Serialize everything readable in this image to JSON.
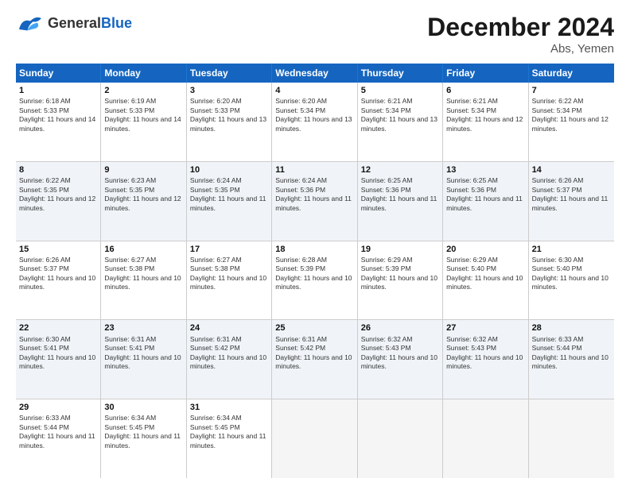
{
  "header": {
    "logo_general": "General",
    "logo_blue": "Blue",
    "month_title": "December 2024",
    "location": "Abs, Yemen"
  },
  "calendar": {
    "days_of_week": [
      "Sunday",
      "Monday",
      "Tuesday",
      "Wednesday",
      "Thursday",
      "Friday",
      "Saturday"
    ],
    "weeks": [
      [
        {
          "day": "1",
          "sunrise": "6:18 AM",
          "sunset": "5:33 PM",
          "daylight": "11 hours and 14 minutes."
        },
        {
          "day": "2",
          "sunrise": "6:19 AM",
          "sunset": "5:33 PM",
          "daylight": "11 hours and 14 minutes."
        },
        {
          "day": "3",
          "sunrise": "6:20 AM",
          "sunset": "5:33 PM",
          "daylight": "11 hours and 13 minutes."
        },
        {
          "day": "4",
          "sunrise": "6:20 AM",
          "sunset": "5:34 PM",
          "daylight": "11 hours and 13 minutes."
        },
        {
          "day": "5",
          "sunrise": "6:21 AM",
          "sunset": "5:34 PM",
          "daylight": "11 hours and 13 minutes."
        },
        {
          "day": "6",
          "sunrise": "6:21 AM",
          "sunset": "5:34 PM",
          "daylight": "11 hours and 12 minutes."
        },
        {
          "day": "7",
          "sunrise": "6:22 AM",
          "sunset": "5:34 PM",
          "daylight": "11 hours and 12 minutes."
        }
      ],
      [
        {
          "day": "8",
          "sunrise": "6:22 AM",
          "sunset": "5:35 PM",
          "daylight": "11 hours and 12 minutes."
        },
        {
          "day": "9",
          "sunrise": "6:23 AM",
          "sunset": "5:35 PM",
          "daylight": "11 hours and 12 minutes."
        },
        {
          "day": "10",
          "sunrise": "6:24 AM",
          "sunset": "5:35 PM",
          "daylight": "11 hours and 11 minutes."
        },
        {
          "day": "11",
          "sunrise": "6:24 AM",
          "sunset": "5:36 PM",
          "daylight": "11 hours and 11 minutes."
        },
        {
          "day": "12",
          "sunrise": "6:25 AM",
          "sunset": "5:36 PM",
          "daylight": "11 hours and 11 minutes."
        },
        {
          "day": "13",
          "sunrise": "6:25 AM",
          "sunset": "5:36 PM",
          "daylight": "11 hours and 11 minutes."
        },
        {
          "day": "14",
          "sunrise": "6:26 AM",
          "sunset": "5:37 PM",
          "daylight": "11 hours and 11 minutes."
        }
      ],
      [
        {
          "day": "15",
          "sunrise": "6:26 AM",
          "sunset": "5:37 PM",
          "daylight": "11 hours and 10 minutes."
        },
        {
          "day": "16",
          "sunrise": "6:27 AM",
          "sunset": "5:38 PM",
          "daylight": "11 hours and 10 minutes."
        },
        {
          "day": "17",
          "sunrise": "6:27 AM",
          "sunset": "5:38 PM",
          "daylight": "11 hours and 10 minutes."
        },
        {
          "day": "18",
          "sunrise": "6:28 AM",
          "sunset": "5:39 PM",
          "daylight": "11 hours and 10 minutes."
        },
        {
          "day": "19",
          "sunrise": "6:29 AM",
          "sunset": "5:39 PM",
          "daylight": "11 hours and 10 minutes."
        },
        {
          "day": "20",
          "sunrise": "6:29 AM",
          "sunset": "5:40 PM",
          "daylight": "11 hours and 10 minutes."
        },
        {
          "day": "21",
          "sunrise": "6:30 AM",
          "sunset": "5:40 PM",
          "daylight": "11 hours and 10 minutes."
        }
      ],
      [
        {
          "day": "22",
          "sunrise": "6:30 AM",
          "sunset": "5:41 PM",
          "daylight": "11 hours and 10 minutes."
        },
        {
          "day": "23",
          "sunrise": "6:31 AM",
          "sunset": "5:41 PM",
          "daylight": "11 hours and 10 minutes."
        },
        {
          "day": "24",
          "sunrise": "6:31 AM",
          "sunset": "5:42 PM",
          "daylight": "11 hours and 10 minutes."
        },
        {
          "day": "25",
          "sunrise": "6:31 AM",
          "sunset": "5:42 PM",
          "daylight": "11 hours and 10 minutes."
        },
        {
          "day": "26",
          "sunrise": "6:32 AM",
          "sunset": "5:43 PM",
          "daylight": "11 hours and 10 minutes."
        },
        {
          "day": "27",
          "sunrise": "6:32 AM",
          "sunset": "5:43 PM",
          "daylight": "11 hours and 10 minutes."
        },
        {
          "day": "28",
          "sunrise": "6:33 AM",
          "sunset": "5:44 PM",
          "daylight": "11 hours and 10 minutes."
        }
      ],
      [
        {
          "day": "29",
          "sunrise": "6:33 AM",
          "sunset": "5:44 PM",
          "daylight": "11 hours and 11 minutes."
        },
        {
          "day": "30",
          "sunrise": "6:34 AM",
          "sunset": "5:45 PM",
          "daylight": "11 hours and 11 minutes."
        },
        {
          "day": "31",
          "sunrise": "6:34 AM",
          "sunset": "5:45 PM",
          "daylight": "11 hours and 11 minutes."
        },
        null,
        null,
        null,
        null
      ]
    ]
  }
}
